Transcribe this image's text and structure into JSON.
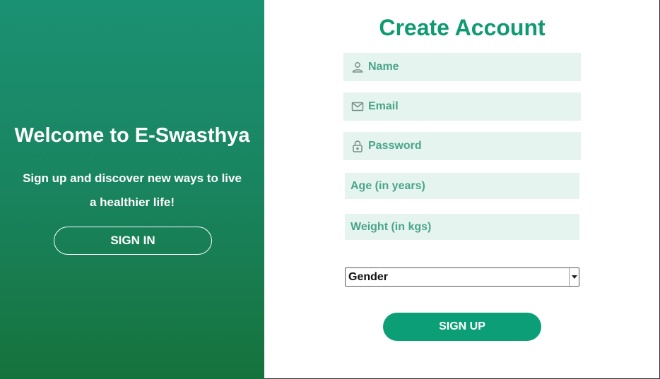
{
  "welcome": {
    "title": "Welcome to E-Swasthya",
    "subtitle": "Sign up and discover new ways to live a healthier life!",
    "signin_label": "SIGN IN"
  },
  "form": {
    "title": "Create Account",
    "name_placeholder": "Name",
    "email_placeholder": "Email",
    "password_placeholder": "Password",
    "age_placeholder": "Age (in years)",
    "weight_placeholder": "Weight (in kgs)",
    "gender_selected": "Gender",
    "signup_label": "SIGN UP"
  },
  "colors": {
    "accent": "#109a72",
    "panel_top": "#1b9173",
    "panel_bottom": "#16723c",
    "field_bg": "#e5f4ef",
    "icon": "#6b8a80"
  },
  "icons": {
    "name": "user-icon",
    "email": "mail-icon",
    "password": "lock-icon",
    "gender": "chevron-down-icon"
  }
}
